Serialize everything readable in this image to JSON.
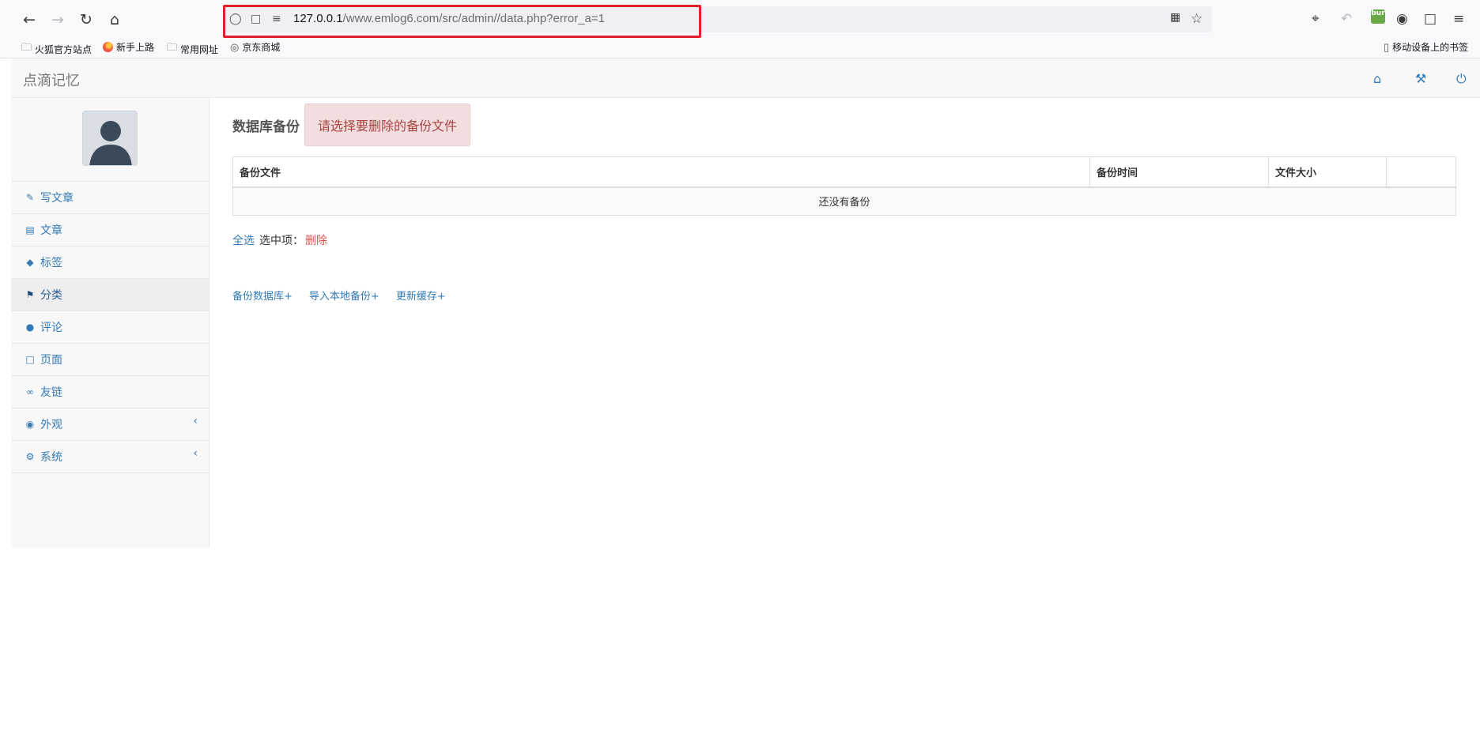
{
  "browser": {
    "url_host": "127.0.0.1",
    "url_path": "/www.emlog6.com/src/admin//data.php?error_a=1",
    "bookmarks": [
      {
        "label": "火狐官方站点"
      },
      {
        "label": "新手上路"
      },
      {
        "label": "常用网址"
      },
      {
        "label": "京东商城"
      }
    ],
    "mobile_bookmarks": "移动设备上的书签",
    "burp_label": "bur"
  },
  "header": {
    "brand": "点滴记忆"
  },
  "sidebar": {
    "items": [
      {
        "label": "写文章",
        "icon": "edit-icon"
      },
      {
        "label": "文章",
        "icon": "list-icon"
      },
      {
        "label": "标签",
        "icon": "tags-icon"
      },
      {
        "label": "分类",
        "icon": "flag-icon",
        "active": true
      },
      {
        "label": "评论",
        "icon": "comments-icon"
      },
      {
        "label": "页面",
        "icon": "file-icon"
      },
      {
        "label": "友链",
        "icon": "link-icon"
      },
      {
        "label": "外观",
        "icon": "eye-icon",
        "expandable": true
      },
      {
        "label": "系统",
        "icon": "gear-icon",
        "expandable": true
      }
    ]
  },
  "main": {
    "title": "数据库备份",
    "alert": "请选择要删除的备份文件",
    "table": {
      "headers": [
        "备份文件",
        "备份时间",
        "文件大小",
        ""
      ],
      "empty_text": "还没有备份"
    },
    "select_all": "全选",
    "selected_label": "选中项：",
    "delete_label": "删除",
    "links": [
      "备份数据库+",
      "导入本地备份+",
      "更新缓存+"
    ]
  },
  "colors": {
    "link": "#337ab7",
    "danger": "#d9534f",
    "alert_bg": "#f2dede",
    "alert_text": "#a94442",
    "url_highlight": "#e0202a"
  }
}
